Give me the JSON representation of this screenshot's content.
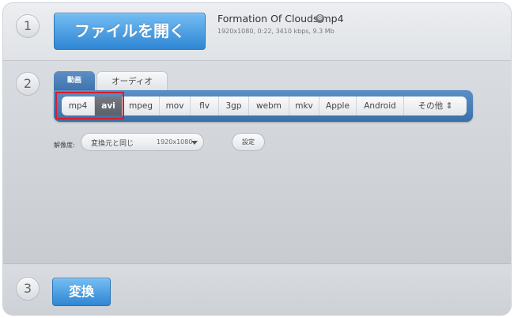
{
  "steps": {
    "one": "1",
    "two": "2",
    "three": "3"
  },
  "open_button": {
    "label": "ファイルを開く"
  },
  "file": {
    "name": "Formation Of Clouds.mp4",
    "meta": "1920x1080, 0:22, 3410 kbps, 9.3 Mb",
    "remove_icon": "⊗"
  },
  "tabs": {
    "video": "動画",
    "audio": "オーディオ"
  },
  "formats": [
    "mp4",
    "avi",
    "mpeg",
    "mov",
    "flv",
    "3gp",
    "webm",
    "mkv",
    "Apple",
    "Android",
    "その他 ⇕"
  ],
  "selected_format": "avi",
  "resolution": {
    "label": "解像度:",
    "value": "変換元と同じ",
    "size": "1920x1080"
  },
  "settings_button": "設定",
  "convert_button": "変換",
  "colors": {
    "accent": "#2f86d3",
    "tab_bar": "#4a80ba",
    "highlight": "#d4202a"
  }
}
